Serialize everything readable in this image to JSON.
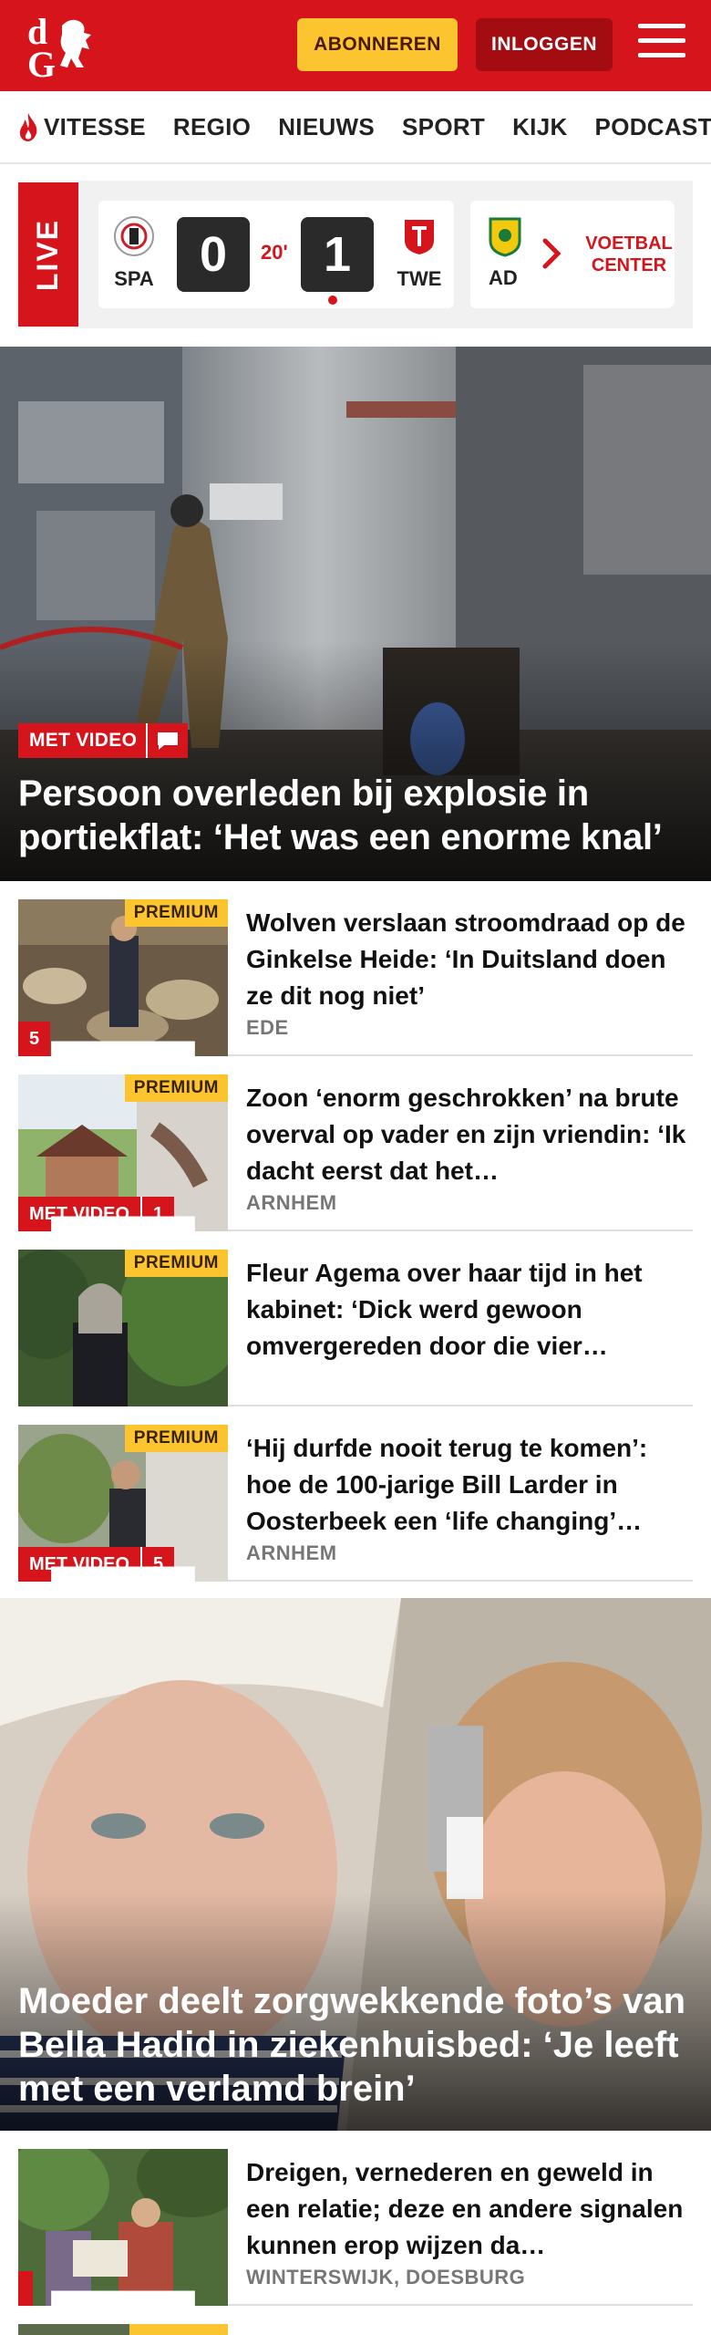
{
  "header": {
    "subscribe_label": "ABONNEREN",
    "login_label": "INLOGGEN",
    "brand_color": "#d5151b"
  },
  "nav": {
    "items": [
      "VITESSE",
      "REGIO",
      "NIEUWS",
      "SPORT",
      "KIJK",
      "PODCAST"
    ]
  },
  "live": {
    "label": "LIVE",
    "match": {
      "home": "SPA",
      "away": "TWE",
      "home_score": "0",
      "away_score": "1",
      "minute": "20'"
    },
    "next_club": "AD",
    "voetbal_center": "VOETBAL CENTER"
  },
  "hero": {
    "badge": "MET VIDEO",
    "title": "Persoon overleden bij explosie in portiekflat: ‘Het was een enorme knal’"
  },
  "articles": [
    {
      "premium": "PREMIUM",
      "title": "Wolven verslaan stroomdraad op de Ginkelse Heide: ‘In Duitsland doen ze dit nog niet’",
      "location": "EDE",
      "comments": "5"
    },
    {
      "premium": "PREMIUM",
      "video": "MET VIDEO",
      "title": "Zoon ‘enorm geschrokken’ na brute overval op vader en zijn vriendin: ‘Ik dacht eerst dat het…",
      "location": "ARNHEM",
      "comments": "1"
    },
    {
      "premium": "PREMIUM",
      "title": "Fleur Agema over haar tijd in het kabinet: ‘Dick werd gewoon omvergereden door die vier…"
    },
    {
      "premium": "PREMIUM",
      "video": "MET VIDEO",
      "title": "‘Hij durfde nooit terug te komen’: hoe de 100-jarige Bill Larder in Oosterbeek een ‘life changing’…",
      "location": "ARNHEM",
      "comments": "5"
    }
  ],
  "hero2": {
    "title": "Moeder deelt zorgwekkende foto’s van Bella Hadid in ziekenhuisbed: ‘Je leeft met een verlamd brein’"
  },
  "article5": {
    "title": "Dreigen, vernederen en geweld in een relatie; deze en andere signalen kunnen erop wijzen da…",
    "location": "WINTERSWIJK, DOESBURG"
  }
}
